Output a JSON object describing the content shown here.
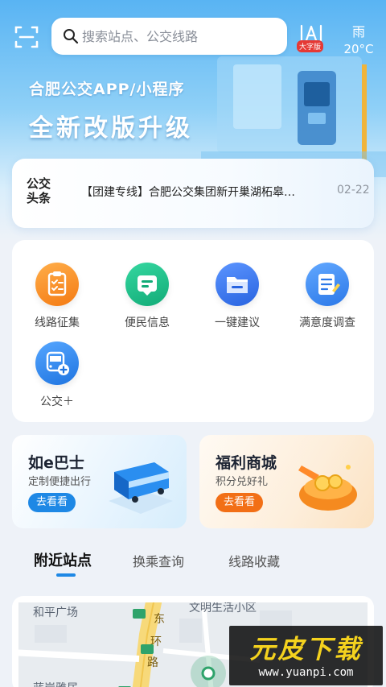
{
  "header": {
    "search_placeholder": "搜索站点、公交线路",
    "big_font_badge": "大字版",
    "weather": {
      "condition": "雨",
      "temperature": "20°C"
    }
  },
  "hero": {
    "title1": "合肥公交APP/小程序",
    "title2": "全新改版升级"
  },
  "news": {
    "logo_line1": "公交",
    "logo_line2": "头条",
    "headline": "【团建专线】合肥公交集团新开巢湖柘皋…",
    "date": "02-22"
  },
  "services": [
    {
      "label": "线路征集",
      "icon": "clipboard-icon",
      "color": "#f98b22"
    },
    {
      "label": "便民信息",
      "icon": "message-icon",
      "color": "#1fc28a"
    },
    {
      "label": "一键建议",
      "icon": "folder-icon",
      "color": "#3a7bf0"
    },
    {
      "label": "满意度调查",
      "icon": "survey-icon",
      "color": "#3d8ef5"
    },
    {
      "label": "公交＋",
      "icon": "bus-plus-icon",
      "color": "#2f8bf2"
    }
  ],
  "promos": [
    {
      "title": "如e巴士",
      "subtitle": "定制便捷出行",
      "button": "去看看",
      "button_color": "#1e88e5"
    },
    {
      "title": "福利商城",
      "subtitle": "积分兑好礼",
      "button": "去看看",
      "button_color": "#f26f16"
    }
  ],
  "tabs": [
    "附近站点",
    "换乘查询",
    "线路收藏"
  ],
  "map": {
    "labels": [
      "和平广场",
      "文明生活小区",
      "东",
      "环",
      "路",
      "蓝岸雅居"
    ]
  },
  "watermark": {
    "title": "元皮下载",
    "url": "www.yuanpi.com"
  }
}
